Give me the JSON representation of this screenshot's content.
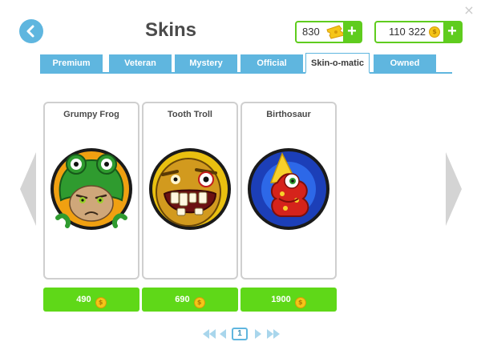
{
  "header": {
    "title": "Skins",
    "tickets": {
      "value": "830",
      "plus": "+"
    },
    "coins": {
      "value": "110 322",
      "plus": "+",
      "coin_glyph": "$"
    },
    "close_glyph": "×"
  },
  "tabs": [
    {
      "label": "Premium",
      "active": false
    },
    {
      "label": "Veteran",
      "active": false
    },
    {
      "label": "Mystery",
      "active": false
    },
    {
      "label": "Official",
      "active": false
    },
    {
      "label": "Skin-o-matic",
      "active": true
    },
    {
      "label": "Owned",
      "active": false
    }
  ],
  "skins": [
    {
      "name": "Grumpy Frog",
      "price": "490"
    },
    {
      "name": "Tooth Troll",
      "price": "690"
    },
    {
      "name": "Birthosaur",
      "price": "1900"
    }
  ],
  "coin_glyph": "$",
  "pagination": {
    "current_page": "1"
  },
  "icons": {
    "back": "chevron-left-icon",
    "close": "close-icon",
    "ticket": "ticket-icon",
    "coin": "coin-icon",
    "prev_page": "arrow-left-icon",
    "next_page": "arrow-right-icon",
    "first_page": "double-arrow-left-icon",
    "last_page": "double-arrow-right-icon"
  },
  "colors": {
    "accent_blue": "#5fb6df",
    "accent_green": "#5fcc1e",
    "price_green": "#5fd818",
    "coin_gold": "#f5c518"
  }
}
